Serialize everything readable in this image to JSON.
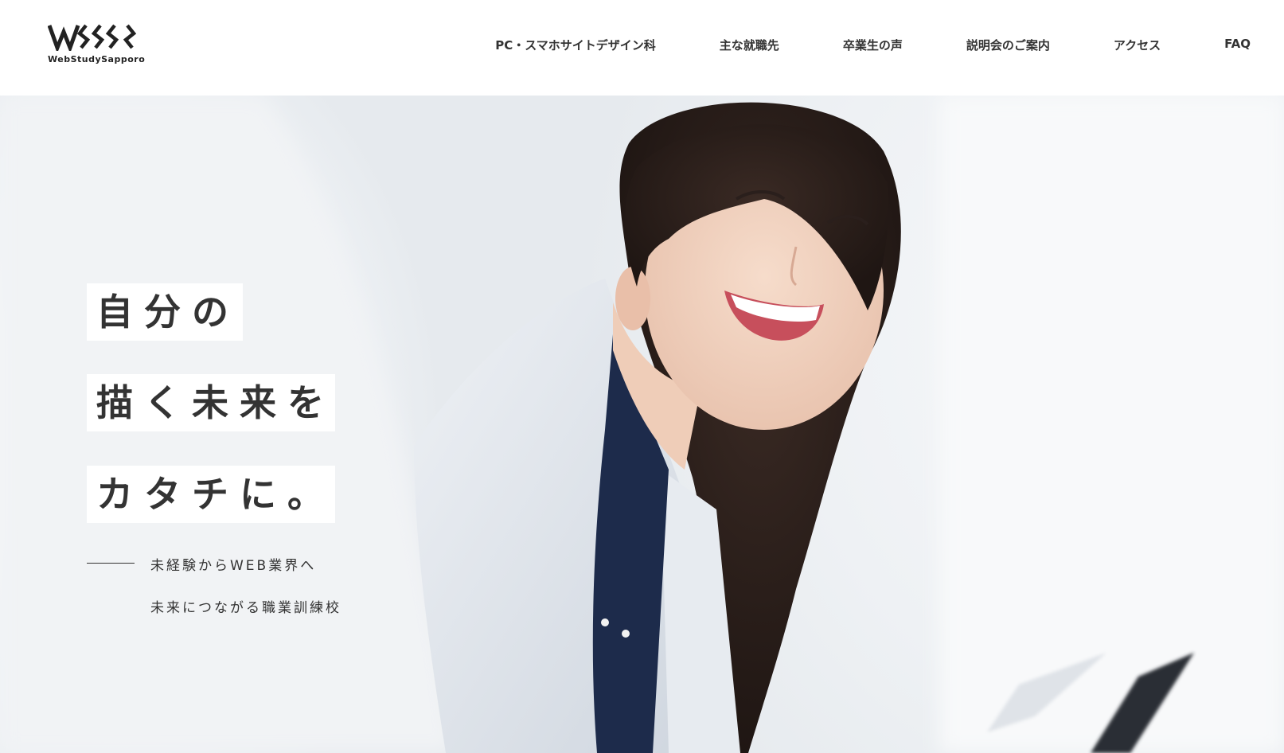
{
  "brand": {
    "name": "WebStudySapporo",
    "mark": "WSS"
  },
  "nav": {
    "items": [
      {
        "label": "PC・スマホサイトデザイン科"
      },
      {
        "label": "主な就職先"
      },
      {
        "label": "卒業生の声"
      },
      {
        "label": "説明会のご案内"
      },
      {
        "label": "アクセス"
      },
      {
        "label": "FAQ"
      }
    ]
  },
  "hero": {
    "catch_lines": [
      "自分の",
      "描く未来を",
      "カタチに。"
    ],
    "sub_lines": [
      "未経験からWEB業界へ",
      "未来につながる職業訓練校"
    ]
  },
  "colors": {
    "text": "#333333",
    "background": "#ffffff"
  }
}
